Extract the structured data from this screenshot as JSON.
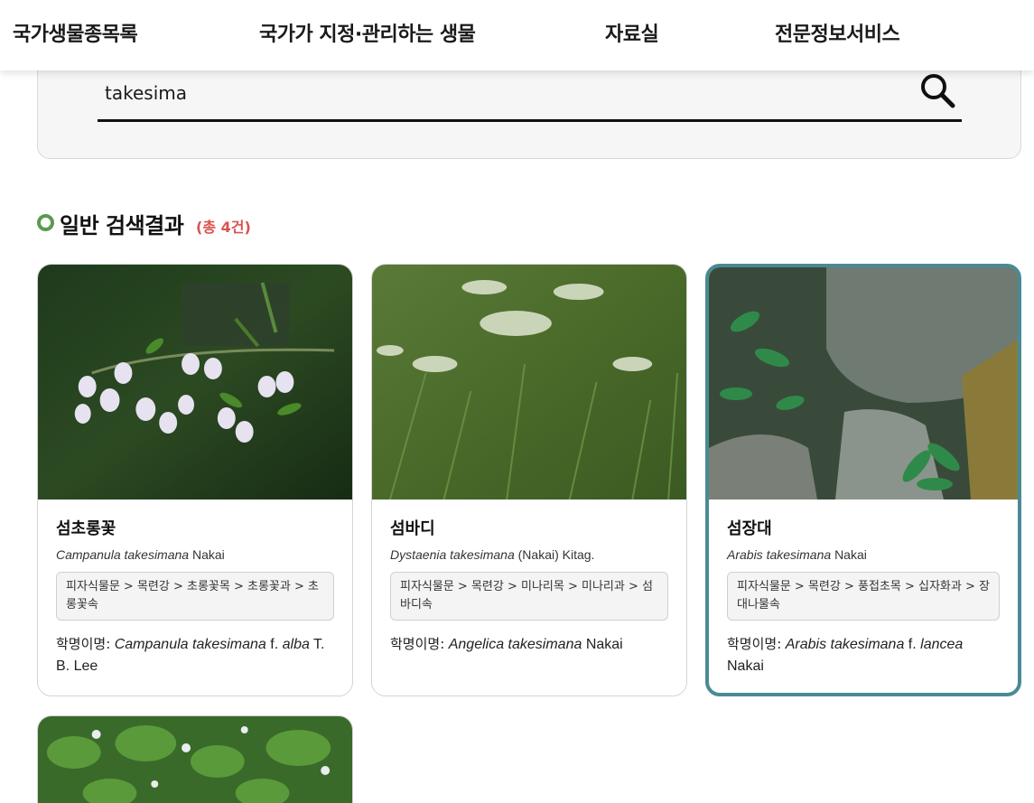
{
  "nav": {
    "items": [
      {
        "label": "국가생물종목록"
      },
      {
        "label": "국가가 지정·관리하는 생물"
      },
      {
        "label": "자료실"
      },
      {
        "label": "전문정보서비스"
      }
    ]
  },
  "search": {
    "value": "takesima",
    "button_icon": "search-icon"
  },
  "results": {
    "title": "일반 검색결과",
    "count": "(총 4건)",
    "icon": "circle-icon",
    "accent_color": "#5a9a4f",
    "count_color": "#d9534f",
    "selected_border_color": "#4a8a96"
  },
  "cards": [
    {
      "name": "섬초롱꽃",
      "sci_genus_species": "Campanula takesimana",
      "sci_author": "Nakai",
      "taxonomy": "피자식물문 > 목련강 > 초롱꽃목 > 초롱꽃과 > 초롱꽃속",
      "synonym_label": "학명이명:",
      "synonym_italic": "Campanula takesimana",
      "synonym_rank": "f.",
      "synonym_infra": "alba",
      "synonym_author": "T. B. Lee"
    },
    {
      "name": "섬바디",
      "sci_genus_species": "Dystaenia takesimana",
      "sci_author": "(Nakai) Kitag.",
      "taxonomy": "피자식물문 > 목련강 > 미나리목 > 미나리과 > 섬바디속",
      "synonym_label": "학명이명:",
      "synonym_italic": "Angelica takesimana",
      "synonym_rank": "",
      "synonym_infra": "",
      "synonym_author": "Nakai"
    },
    {
      "name": "섬장대",
      "sci_genus_species": "Arabis takesimana",
      "sci_author": "Nakai",
      "taxonomy": "피자식물문 > 목련강 > 풍접초목 > 십자화과 > 장대나물속",
      "synonym_label": "학명이명:",
      "synonym_italic": "Arabis takesimana",
      "synonym_rank": "f.",
      "synonym_infra": "lancea",
      "synonym_author": "Nakai"
    }
  ]
}
